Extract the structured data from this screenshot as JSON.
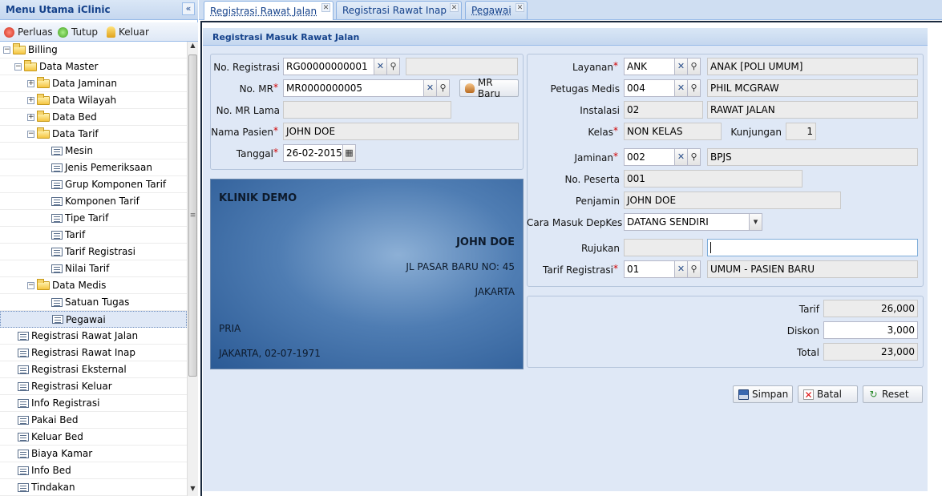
{
  "sidebar": {
    "title": "Menu Utama iClinic",
    "collapse_glyph": "«",
    "toolbar": {
      "expand": "Perluas",
      "collapse": "Tutup",
      "logout": "Keluar"
    },
    "tree": [
      {
        "label": "Billing",
        "level": 0,
        "type": "folder"
      },
      {
        "label": "Data Master",
        "level": 1,
        "type": "folder"
      },
      {
        "label": "Data Jaminan",
        "level": 2,
        "type": "folder"
      },
      {
        "label": "Data Wilayah",
        "level": 2,
        "type": "folder"
      },
      {
        "label": "Data Bed",
        "level": 2,
        "type": "folder"
      },
      {
        "label": "Data Tarif",
        "level": 2,
        "type": "folder"
      },
      {
        "label": "Mesin",
        "level": 3,
        "type": "leaf"
      },
      {
        "label": "Jenis Pemeriksaan",
        "level": 3,
        "type": "leaf"
      },
      {
        "label": "Grup Komponen Tarif",
        "level": 3,
        "type": "leaf"
      },
      {
        "label": "Komponen Tarif",
        "level": 3,
        "type": "leaf"
      },
      {
        "label": "Tipe Tarif",
        "level": 3,
        "type": "leaf"
      },
      {
        "label": "Tarif",
        "level": 3,
        "type": "leaf"
      },
      {
        "label": "Tarif Registrasi",
        "level": 3,
        "type": "leaf"
      },
      {
        "label": "Nilai Tarif",
        "level": 3,
        "type": "leaf"
      },
      {
        "label": "Data Medis",
        "level": 2,
        "type": "folder"
      },
      {
        "label": "Satuan Tugas",
        "level": 3,
        "type": "leaf"
      },
      {
        "label": "Pegawai",
        "level": 3,
        "type": "leaf"
      },
      {
        "label": "Registrasi Rawat Jalan",
        "level": 1,
        "type": "leaf"
      },
      {
        "label": "Registrasi Rawat Inap",
        "level": 1,
        "type": "leaf"
      },
      {
        "label": "Registrasi Eksternal",
        "level": 1,
        "type": "leaf"
      },
      {
        "label": "Registrasi Keluar",
        "level": 1,
        "type": "leaf"
      },
      {
        "label": "Info Registrasi",
        "level": 1,
        "type": "leaf"
      },
      {
        "label": "Pakai Bed",
        "level": 1,
        "type": "leaf"
      },
      {
        "label": "Keluar Bed",
        "level": 1,
        "type": "leaf"
      },
      {
        "label": "Biaya Kamar",
        "level": 1,
        "type": "leaf"
      },
      {
        "label": "Info Bed",
        "level": 1,
        "type": "leaf"
      },
      {
        "label": "Tindakan",
        "level": 1,
        "type": "leaf"
      }
    ]
  },
  "tabs": [
    {
      "label": "Registrasi Rawat Jalan",
      "active": true
    },
    {
      "label": "Registrasi Rawat Inap",
      "active": false
    },
    {
      "label": "Pegawai",
      "active": false
    }
  ],
  "form": {
    "title": "Registrasi Masuk Rawat Jalan",
    "no_registrasi": {
      "label": "No. Registrasi",
      "value": "RG00000000001"
    },
    "no_mr": {
      "label": "No. MR",
      "value": "MR0000000005",
      "button": "MR Baru"
    },
    "no_mr_lama": {
      "label": "No. MR Lama",
      "value": ""
    },
    "nama_pasien": {
      "label": "Nama Pasien",
      "value": "JOHN DOE"
    },
    "tanggal": {
      "label": "Tanggal",
      "value": "26-02-2015"
    },
    "layanan": {
      "label": "Layanan",
      "code": "ANK",
      "name": "ANAK [POLI UMUM]"
    },
    "petugas_medis": {
      "label": "Petugas Medis",
      "code": "004",
      "name": "PHIL MCGRAW"
    },
    "instalasi": {
      "label": "Instalasi",
      "code": "02",
      "name": "RAWAT JALAN"
    },
    "kelas": {
      "label": "Kelas",
      "value": "NON KELAS",
      "kunjungan_label": "Kunjungan",
      "kunjungan_value": "1"
    },
    "jaminan": {
      "label": "Jaminan",
      "code": "002",
      "name": "BPJS"
    },
    "no_peserta": {
      "label": "No. Peserta",
      "value": "001"
    },
    "penjamin": {
      "label": "Penjamin",
      "value": "JOHN DOE"
    },
    "cara_masuk": {
      "label": "Cara Masuk DepKes",
      "value": "DATANG SENDIRI"
    },
    "rujukan": {
      "label": "Rujukan",
      "code": "",
      "name": ""
    },
    "tarif_registrasi": {
      "label": "Tarif Registrasi",
      "code": "01",
      "name": "UMUM - PASIEN BARU"
    },
    "required_mark": "*"
  },
  "card": {
    "clinic": "KLINIK DEMO",
    "name": "JOHN DOE",
    "address": "JL PASAR BARU NO: 45",
    "city": "JAKARTA",
    "gender": "PRIA",
    "birth": "JAKARTA, 02-07-1971"
  },
  "totals": {
    "tarif_label": "Tarif",
    "tarif_value": "26,000",
    "diskon_label": "Diskon",
    "diskon_value": "3,000",
    "total_label": "Total",
    "total_value": "23,000"
  },
  "actions": {
    "save": "Simpan",
    "cancel": "Batal",
    "reset": "Reset"
  },
  "colors": {
    "accent": "#15428b",
    "panel": "#dfe8f6",
    "required": "#d00000"
  }
}
